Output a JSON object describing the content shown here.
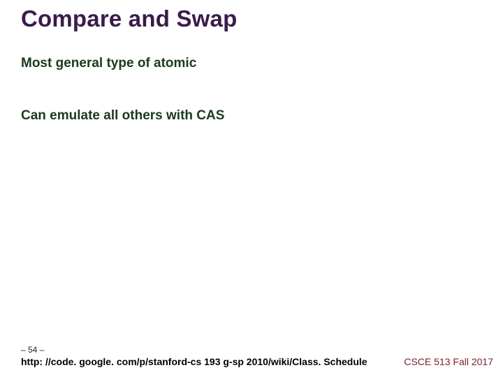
{
  "title": "Compare and Swap",
  "lines": {
    "l1": "Most general type of atomic",
    "l2": "Can emulate all others with CAS"
  },
  "footer": {
    "page": "– 54 –",
    "link": "http: //code. google. com/p/stanford-cs 193 g-sp 2010/wiki/Class. Schedule",
    "course": "CSCE 513 Fall 2017"
  }
}
